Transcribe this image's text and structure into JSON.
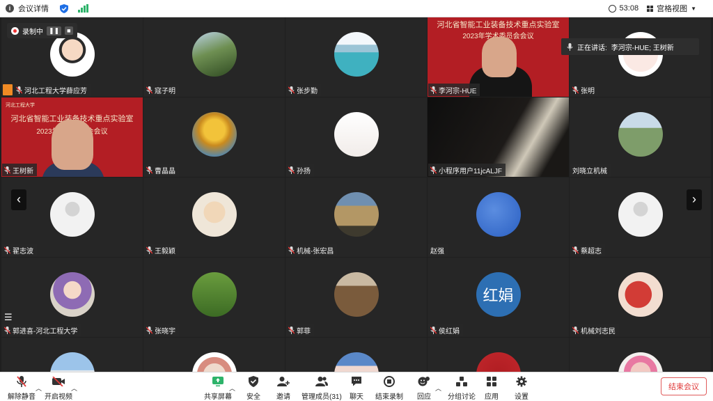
{
  "topbar": {
    "meeting_info_label": "会议详情",
    "timer": "53:08",
    "view_label": "宫格视图"
  },
  "recording": {
    "label": "录制中"
  },
  "speaking": {
    "label": "正在讲话:",
    "names": "李河宗-HUE; 王树新"
  },
  "tiles": [
    {
      "name": "河北工程大学薛应芳",
      "kind": "avatar",
      "pic": "cartoon",
      "host": true
    },
    {
      "name": "寇子明",
      "kind": "avatar",
      "pic": "palm"
    },
    {
      "name": "张步勤",
      "kind": "avatar",
      "pic": "lake"
    },
    {
      "name": "李河宗-HUE",
      "kind": "video-red",
      "active": true
    },
    {
      "name": "张明",
      "kind": "avatar",
      "pic": "doodle"
    },
    {
      "name": "王树新",
      "kind": "video-red2"
    },
    {
      "name": "曹晶晶",
      "kind": "avatar",
      "pic": "autumn"
    },
    {
      "name": "孙扬",
      "kind": "avatar",
      "pic": "sketch"
    },
    {
      "name": "小程序用户11jcALJF",
      "kind": "dark"
    },
    {
      "name": "刘晓立机械",
      "kind": "avatar",
      "pic": "campus",
      "nomic": true
    },
    {
      "name": "翟志波",
      "kind": "avatar",
      "pic": "default"
    },
    {
      "name": "王毅颖",
      "kind": "avatar",
      "pic": "hat"
    },
    {
      "name": "机械-张宏昌",
      "kind": "avatar",
      "pic": "gate"
    },
    {
      "name": "赵强",
      "kind": "avatar",
      "pic": "blue",
      "nomic": true
    },
    {
      "name": "蔡超志",
      "kind": "avatar",
      "pic": "default"
    },
    {
      "name": "郭进喜-河北工程大学",
      "kind": "avatar",
      "pic": "baby"
    },
    {
      "name": "张晓宇",
      "kind": "avatar",
      "pic": "grass"
    },
    {
      "name": "郭菲",
      "kind": "avatar",
      "pic": "forest"
    },
    {
      "name": "侯红娟",
      "kind": "avatar",
      "pic": "letter",
      "letters": "红娟"
    },
    {
      "name": "机械刘志民",
      "kind": "avatar",
      "pic": "map"
    },
    {
      "name": "",
      "kind": "avatar",
      "pic": "hills"
    },
    {
      "name": "",
      "kind": "avatar",
      "pic": "girl"
    },
    {
      "name": "",
      "kind": "avatar",
      "pic": "cloud"
    },
    {
      "name": "",
      "kind": "avatar",
      "pic": "badge"
    },
    {
      "name": "",
      "kind": "avatar",
      "pic": "child"
    }
  ],
  "slide": {
    "title": "河北省智能工业装备技术重点实验室",
    "subtitle": "2023年学术委员会会议",
    "school_logo_text": "河北工程大学"
  },
  "toolbar": {
    "mute_label": "解除静音",
    "video_label": "开启视频",
    "share_label": "共享屏幕",
    "security_label": "安全",
    "invite_label": "邀请",
    "participants_label": "管理成员(31)",
    "chat_label": "聊天",
    "record_label": "结束录制",
    "reaction_label": "回应",
    "breakout_label": "分组讨论",
    "apps_label": "应用",
    "settings_label": "设置",
    "end_label": "结束会议"
  }
}
